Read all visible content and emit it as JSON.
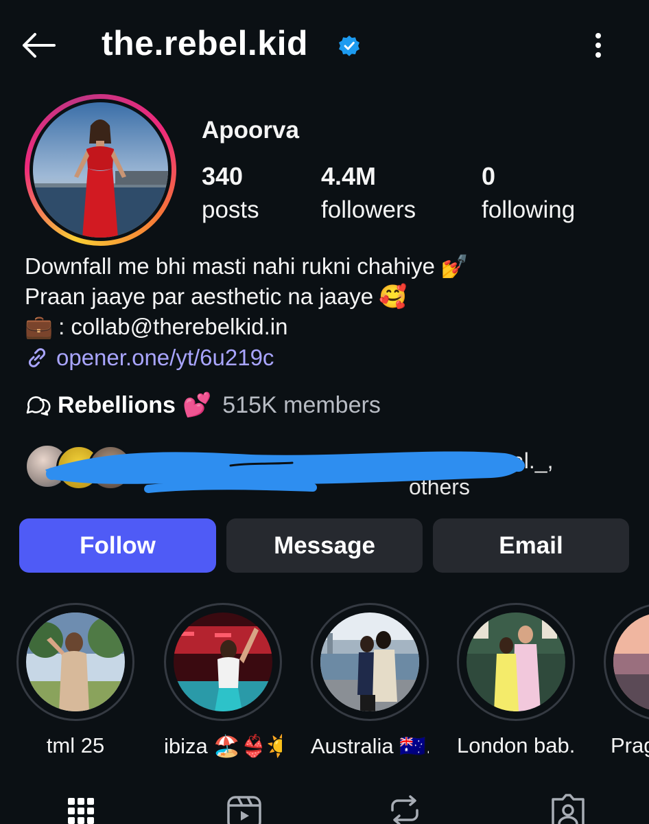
{
  "header": {
    "username": "the.rebel.kid",
    "verified": true,
    "back_icon": "arrow-left-icon",
    "menu_icon": "kebab-menu-icon"
  },
  "profile": {
    "full_name": "Apoorva",
    "stats": [
      {
        "value": "340",
        "label": "posts"
      },
      {
        "value": "4.4M",
        "label": "followers"
      },
      {
        "value": "0",
        "label": "following"
      }
    ],
    "bio": {
      "line1": "Downfall me bhi masti nahi rukni chahiye",
      "line1_emoji": "💅",
      "line2": "Praan jaaye par aesthetic na jaaye",
      "line2_emoji": "🥰",
      "line3_emoji": "💼",
      "line3": ": collab@therebelkid.in"
    },
    "link": "opener.one/yt/6u219c"
  },
  "channel": {
    "name": "Rebellions",
    "emoji": "💕",
    "members": "515K members"
  },
  "mutual": {
    "text_tail": "al._,",
    "text_line2_tail": "others"
  },
  "actions": {
    "follow": "Follow",
    "message": "Message",
    "email": "Email"
  },
  "highlights": [
    {
      "label": "tml 25"
    },
    {
      "label": "ibiza 🏖️👙☀️"
    },
    {
      "label": "Australia 🇦🇺..."
    },
    {
      "label": "London bab..."
    },
    {
      "label": "Prag"
    }
  ],
  "tabs": [
    "grid-icon",
    "reels-icon",
    "reposts-icon",
    "tagged-icon"
  ],
  "colors": {
    "background": "#0b1014",
    "follow_button": "#4f5bf6",
    "secondary_button": "#26292f",
    "link": "#a9a5ff",
    "verified": "#1d9bf0"
  }
}
